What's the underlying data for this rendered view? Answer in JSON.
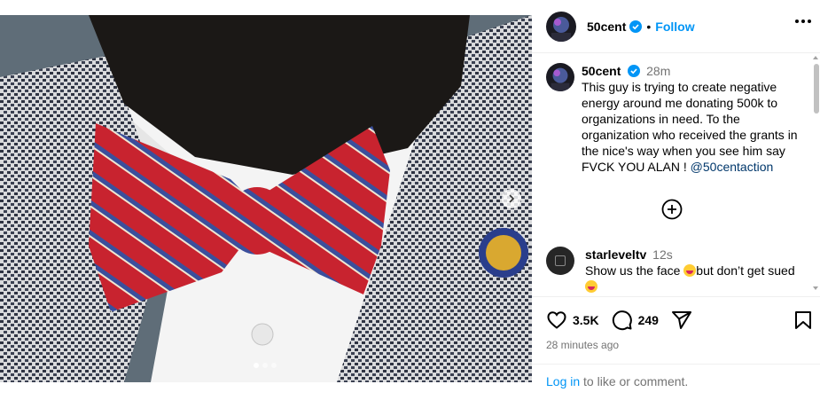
{
  "header": {
    "username": "50cent",
    "separator": "•",
    "follow_label": "Follow",
    "icons": [
      "verified-badge-icon",
      "more-options-icon"
    ]
  },
  "caption": {
    "username": "50cent",
    "time": "28m",
    "text": "This guy is trying to create negative energy around me donating 500k to organizations in need. To the organization who received the grants in the nice's way when you see him say FVCK YOU ALAN ! ",
    "mention": "@50centaction"
  },
  "comment": {
    "username": "starlevеltv",
    "time": "12s",
    "text_part1": "Show us the face ",
    "text_part2": "but don’t get sued",
    "emoji": "laughing-face-emoji"
  },
  "actions": {
    "likes": "3.5K",
    "comments": "249",
    "timestamp": "28 minutes ago"
  },
  "login": {
    "link": "Log in",
    "text": " to like or comment."
  },
  "media": {
    "carousel_dots": 3,
    "active_dot": 1,
    "colors": {
      "tie_red": "#c8232f",
      "tie_blue": "#3b4f9c",
      "jacket": "#9aa1a7"
    }
  },
  "colors": {
    "accent": "#0095f6",
    "muted": "#737373",
    "link_dark": "#00376b"
  }
}
